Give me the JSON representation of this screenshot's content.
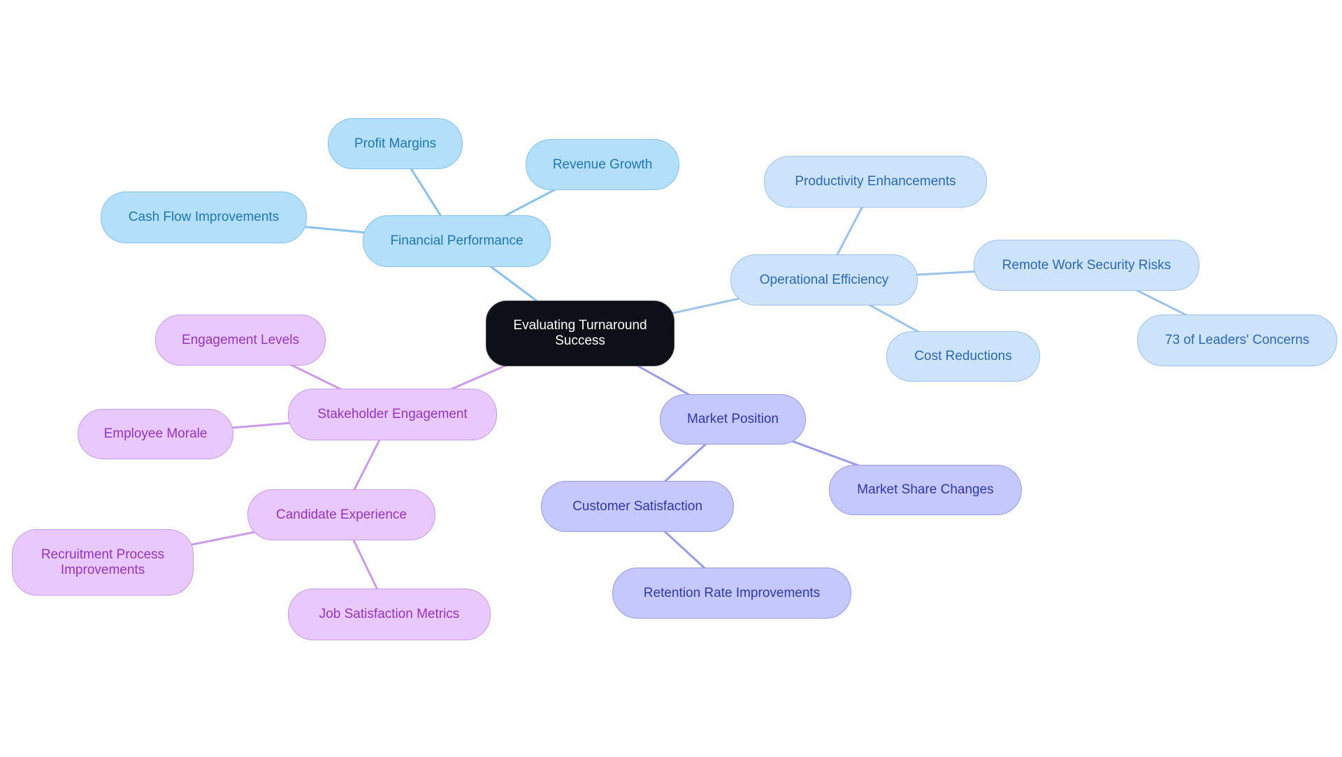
{
  "diagram": {
    "type": "mindmap",
    "root": {
      "id": "root",
      "label": "Evaluating Turnaround Success"
    },
    "branches": [
      {
        "id": "fin",
        "label": "Financial Performance",
        "fill": "#b3dffb",
        "stroke": "#86c2ec",
        "text": "#1e76b4",
        "children": [
          {
            "id": "fin-1",
            "label": "Profit Margins"
          },
          {
            "id": "fin-2",
            "label": "Revenue Growth"
          },
          {
            "id": "fin-3",
            "label": "Cash Flow Improvements"
          }
        ]
      },
      {
        "id": "ops",
        "label": "Operational Efficiency",
        "fill": "#cce3fb",
        "stroke": "#9cc3ec",
        "text": "#2a67b5",
        "children": [
          {
            "id": "ops-1",
            "label": "Productivity Enhancements"
          },
          {
            "id": "ops-2",
            "label": "Remote Work Security Risks",
            "children": [
              {
                "id": "ops-2-1",
                "label": "73 of Leaders' Concerns"
              }
            ]
          },
          {
            "id": "ops-3",
            "label": "Cost Reductions"
          }
        ]
      },
      {
        "id": "mkt",
        "label": "Market Position",
        "fill": "#c5c8fd",
        "stroke": "#979ce8",
        "text": "#2f37a8",
        "children": [
          {
            "id": "mkt-1",
            "label": "Customer Satisfaction",
            "children": [
              {
                "id": "mkt-1-1",
                "label": "Retention Rate Improvements"
              }
            ]
          },
          {
            "id": "mkt-2",
            "label": "Market Share Changes"
          }
        ]
      },
      {
        "id": "stk",
        "label": "Stakeholder Engagement",
        "fill": "#e9c9fd",
        "stroke": "#cc9ae8",
        "text": "#9333c2",
        "children": [
          {
            "id": "stk-1",
            "label": "Engagement Levels"
          },
          {
            "id": "stk-2",
            "label": "Employee Morale"
          },
          {
            "id": "stk-3",
            "label": "Candidate Experience",
            "children": [
              {
                "id": "stk-3-1",
                "label": "Recruitment Process Improvements"
              },
              {
                "id": "stk-3-2",
                "label": "Job Satisfaction Metrics"
              }
            ]
          }
        ]
      }
    ],
    "root_fill": "#0d1117",
    "root_text": "#ffffff"
  }
}
